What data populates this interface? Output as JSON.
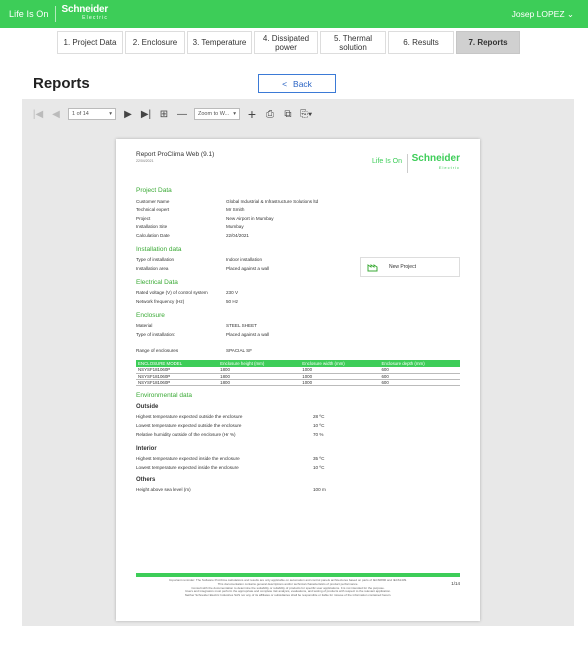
{
  "header": {
    "life_is_on": "Life Is On",
    "brand_name": "Schneider",
    "brand_sub": "Electric",
    "user": "Josep LOPEZ ⌄"
  },
  "tabs": [
    "1. Project Data",
    "2. Enclosure",
    "3. Temperature",
    "4. Dissipated power",
    "5. Thermal solution",
    "6. Results",
    "7. Reports"
  ],
  "page_title": "Reports",
  "back_button": {
    "arrow": "<",
    "label": "Back"
  },
  "toolbar": {
    "page_select": "1 of 14",
    "zoom_select": "Zoom to W...",
    "icons": [
      "first-page-icon",
      "prev-page-icon",
      "next-page-icon",
      "last-page-icon",
      "toggle-view-icon",
      "zoom-out-icon",
      "zoom-in-icon",
      "print-icon",
      "print-layout-icon",
      "export-icon"
    ]
  },
  "report": {
    "title": "Report ProClima Web (9.1)",
    "date": "22/04/2021",
    "life_is_on": "Life Is On",
    "brand_name": "Schneider",
    "brand_sub": "Electric",
    "project_data_heading": "Project Data",
    "project_data": [
      {
        "k": "Customer Name",
        "v": "Global Industrial & Infrastructure Solutions ltd"
      },
      {
        "k": "Technical expert",
        "v": "Mr Smith"
      },
      {
        "k": "Project",
        "v": "New Airport in Mumbay"
      },
      {
        "k": "Installation Site",
        "v": "Mumbay"
      },
      {
        "k": "Calculation Date",
        "v": "22/04/2021"
      }
    ],
    "installation_heading": "Installation data",
    "installation": [
      {
        "k": "Type of installation",
        "v": "Indoor installation"
      },
      {
        "k": "Installation area",
        "v": "Placed against a wall"
      }
    ],
    "badge_label": "New Project",
    "electrical_heading": "Electrical Data",
    "electrical": [
      {
        "k": "Rated voltage (V) of control system",
        "v": "230 V"
      },
      {
        "k": "Network frequency (Hz)",
        "v": "50 Hz"
      }
    ],
    "enclosure_heading": "Enclosure",
    "enclosure": [
      {
        "k": "Material",
        "v": "STEEL SHEET"
      },
      {
        "k": "Type of installation:",
        "v": "Placed against a wall"
      }
    ],
    "range": {
      "k": "Range of enclosures",
      "v": "SPACIAL SF"
    },
    "table_headers": [
      "ENCLOSURE MODEL",
      "Enclosure height (mm)",
      "Enclosure width (mm)",
      "Enclosure depth (mm)"
    ],
    "table_rows": [
      [
        "NSYSF181060P",
        "1800",
        "1000",
        "600"
      ],
      [
        "NSYSF181060P",
        "1800",
        "1000",
        "600"
      ],
      [
        "NSYSF181060P",
        "1800",
        "1000",
        "600"
      ]
    ],
    "env_heading": "Environmental data",
    "outside_heading": "Outside",
    "outside": [
      {
        "k": "Highest temperature expected outside the enclosure",
        "v": "28 ºC"
      },
      {
        "k": "Lowest temperature expected outside the enclosure",
        "v": "10 ºC"
      },
      {
        "k": "Relative humidity outside of the enclosure (Hr %)",
        "v": "70 %"
      }
    ],
    "interior_heading": "Interior",
    "interior": [
      {
        "k": "Highest temperature expected inside the enclosure",
        "v": "35 ºC"
      },
      {
        "k": "Lowest temperature expected inside the enclosure",
        "v": "10 ºC"
      }
    ],
    "others_heading": "Others",
    "others": [
      {
        "k": "Height above sea level (m)",
        "v": "100 m"
      }
    ],
    "footer_lines": [
      "Important reminder: The Software ProClima calculations and results are only applicable on automation and control panels architectures based on parts of IEC60890 and IEC61439.",
      "This documentation contains general descriptions and/or technical characteristics of product performance.",
      "Consult with the documentation to determine the suitability or reliability of products for specific user applications. It is not intended for the purpose.",
      "Users and integrators must perform the appropriate and complete risk analysis, evaluations, and testing of products with respect to the relevant application.",
      "Neither Schneider Electric Industries SAS nor any of its affiliates or subsidiaries shall be responsible or liable for misuse of the information contained herein."
    ],
    "page_number": "1/14"
  }
}
